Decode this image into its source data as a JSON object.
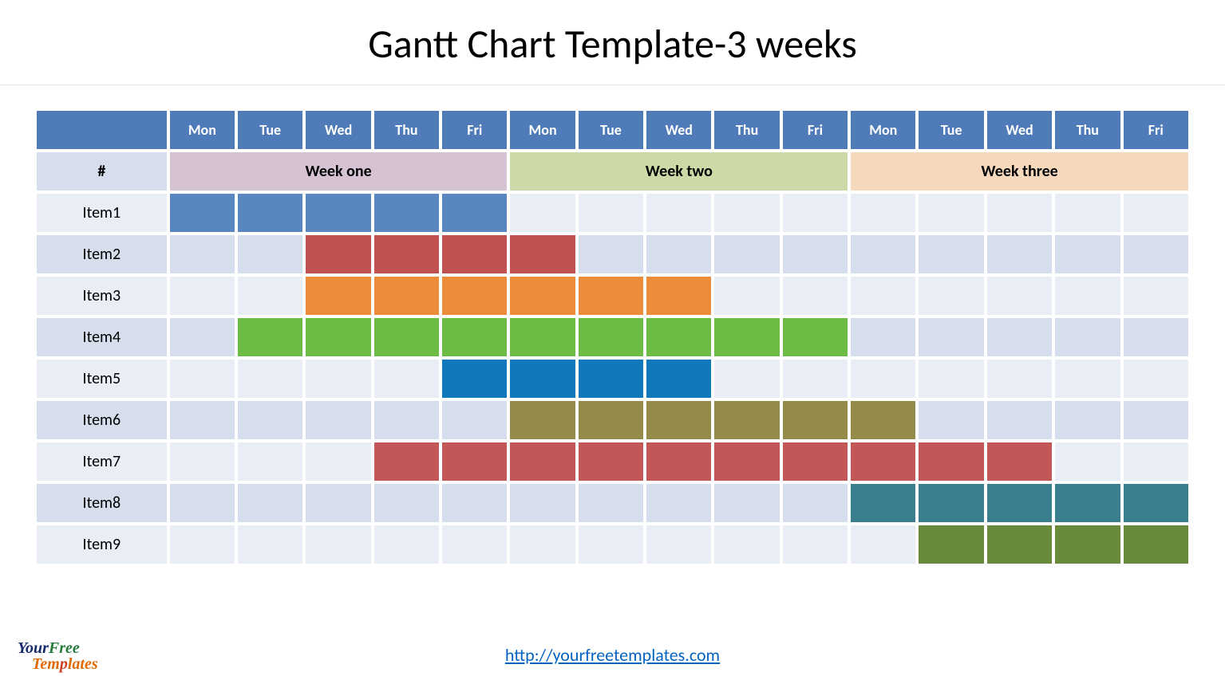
{
  "title": "Gantt Chart Template-3 weeks",
  "link": "http://yourfreetemplates.com",
  "logo": {
    "line1a": "Your",
    "line1b": "Free",
    "line2": "Templates"
  },
  "hash": "#",
  "days": [
    "Mon",
    "Tue",
    "Wed",
    "Thu",
    "Fri",
    "Mon",
    "Tue",
    "Wed",
    "Thu",
    "Fri",
    "Mon",
    "Tue",
    "Wed",
    "Thu",
    "Fri"
  ],
  "weeks": [
    {
      "label": "Week one",
      "span": 5,
      "cls": "week-1"
    },
    {
      "label": "Week two",
      "span": 5,
      "cls": "week-2"
    },
    {
      "label": "Week three",
      "span": 5,
      "cls": "week-3"
    }
  ],
  "chart_data": {
    "type": "bar",
    "title": "Gantt Chart Template-3 weeks",
    "xlabel": "",
    "ylabel": "",
    "categories": [
      "Mon",
      "Tue",
      "Wed",
      "Thu",
      "Fri",
      "Mon",
      "Tue",
      "Wed",
      "Thu",
      "Fri",
      "Mon",
      "Tue",
      "Wed",
      "Thu",
      "Fri"
    ],
    "series": [
      {
        "name": "Item1",
        "start": 1,
        "end": 5,
        "color": "#5985c0"
      },
      {
        "name": "Item2",
        "start": 3,
        "end": 6,
        "color": "#c15151"
      },
      {
        "name": "Item3",
        "start": 3,
        "end": 8,
        "color": "#ec8b3a"
      },
      {
        "name": "Item4",
        "start": 2,
        "end": 10,
        "color": "#6bbb45"
      },
      {
        "name": "Item5",
        "start": 5,
        "end": 8,
        "color": "#0f77bc"
      },
      {
        "name": "Item6",
        "start": 6,
        "end": 11,
        "color": "#948b4a"
      },
      {
        "name": "Item7",
        "start": 4,
        "end": 13,
        "color": "#c15757"
      },
      {
        "name": "Item8",
        "start": 11,
        "end": 15,
        "color": "#397f8d"
      },
      {
        "name": "Item9",
        "start": 12,
        "end": 15,
        "color": "#688a3a"
      }
    ],
    "color_classes": {
      "#5985c0": "c-blue",
      "#c15151": "c-red",
      "#ec8b3a": "c-orange",
      "#6bbb45": "c-green",
      "#0f77bc": "c-dkblue",
      "#948b4a": "c-olive",
      "#c15757": "c-red2",
      "#397f8d": "c-teal",
      "#688a3a": "c-darkgreen"
    }
  }
}
